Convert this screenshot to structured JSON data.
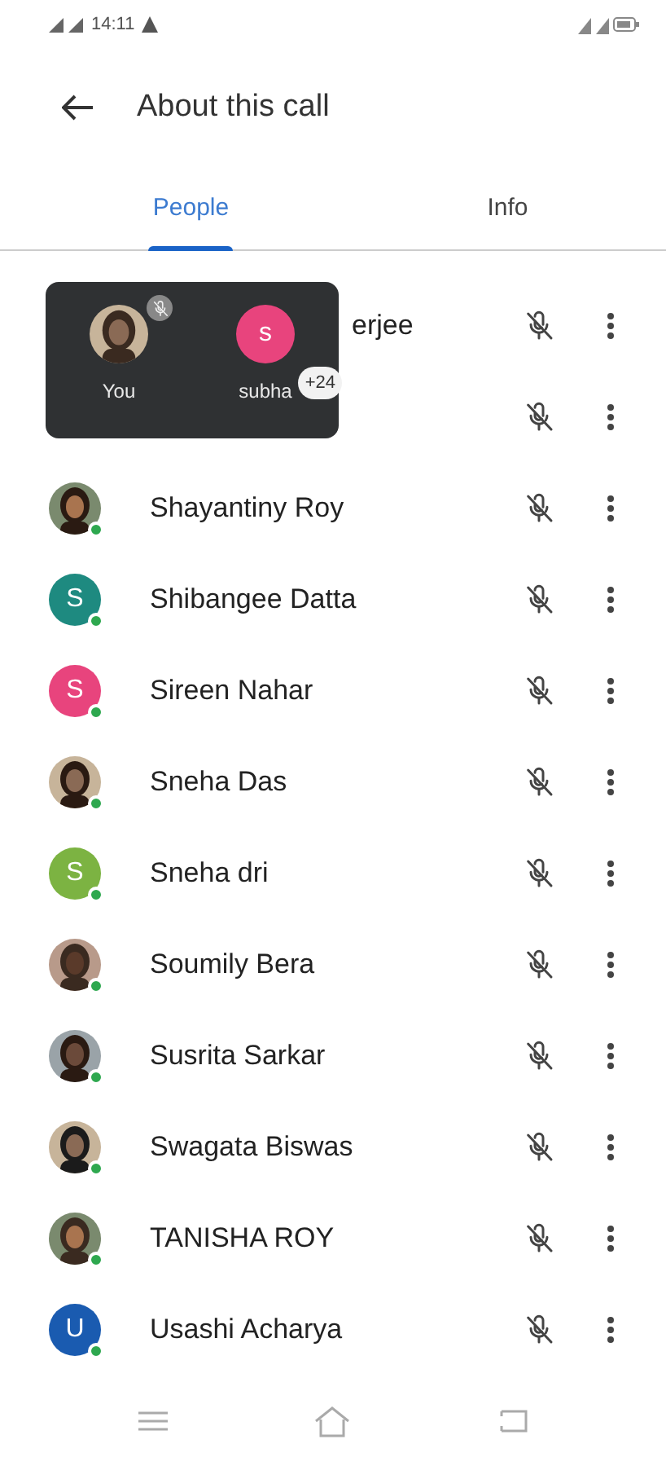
{
  "status_bar": {
    "time": "14:11"
  },
  "header": {
    "title": "About this call"
  },
  "tabs": [
    {
      "label": "People",
      "selected": true
    },
    {
      "label": "Info",
      "selected": false
    }
  ],
  "participants": [
    {
      "name": "erjee",
      "kind": "covered"
    },
    {
      "kind": "hidden"
    },
    {
      "name": "Shayantiny Roy",
      "kind": "normal"
    },
    {
      "name": "Shibangee Datta",
      "kind": "normal",
      "avatar": {
        "kind": "letter",
        "letter": "S",
        "color": "#1e8a80"
      }
    },
    {
      "name": "Sireen Nahar",
      "kind": "normal",
      "avatar": {
        "kind": "letter",
        "letter": "S",
        "color": "#e8447d"
      }
    },
    {
      "name": "Sneha Das",
      "kind": "normal"
    },
    {
      "name": "Sneha dri",
      "kind": "normal",
      "avatar": {
        "kind": "letter",
        "letter": "S",
        "color": "#7cb342"
      }
    },
    {
      "name": "Soumily Bera",
      "kind": "normal"
    },
    {
      "name": "Susrita Sarkar",
      "kind": "normal"
    },
    {
      "name": "Swagata Biswas",
      "kind": "normal"
    },
    {
      "name": "TANISHA ROY",
      "kind": "normal"
    },
    {
      "name": "Usashi Acharya",
      "kind": "normal",
      "avatar": {
        "kind": "letter",
        "letter": "U",
        "color": "#1a5bb0"
      }
    }
  ],
  "floating_tile": {
    "tiles": [
      {
        "label": "You"
      },
      {
        "label": "subha",
        "avatar": {
          "kind": "letter",
          "letter": "s",
          "color": "#e8447d"
        }
      }
    ],
    "more_count": "+24"
  }
}
